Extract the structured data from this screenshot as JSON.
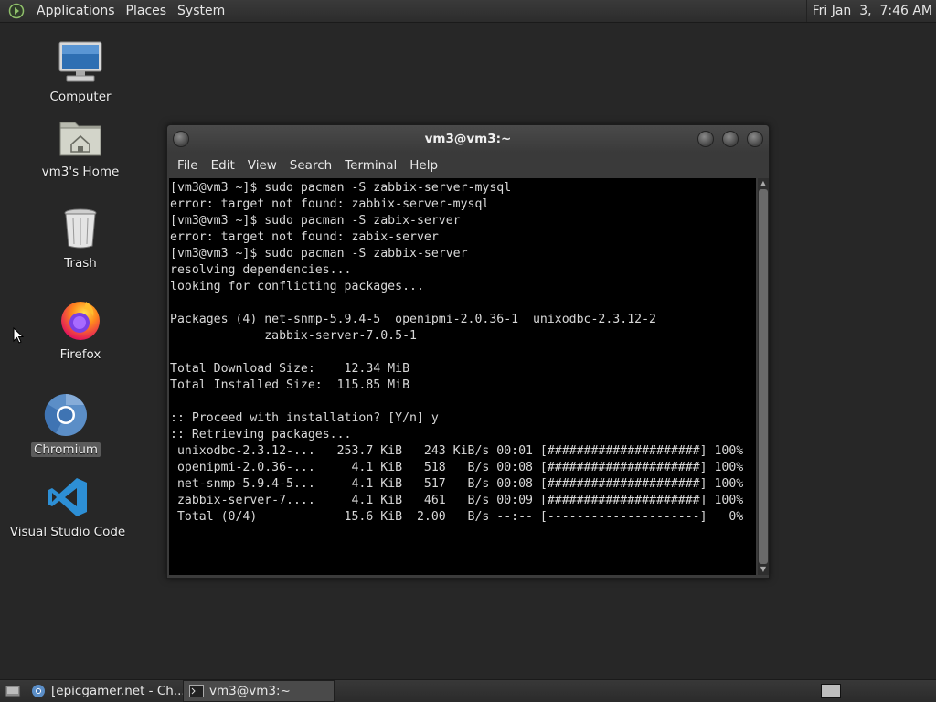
{
  "top_panel": {
    "menus": [
      "Applications",
      "Places",
      "System"
    ],
    "clock": "Fri Jan  3,  7:46 AM"
  },
  "desktop_icons": [
    {
      "label": "Computer",
      "icon": "computer-icon"
    },
    {
      "label": "vm3's Home",
      "icon": "home-folder-icon"
    },
    {
      "label": "Trash",
      "icon": "trash-icon"
    },
    {
      "label": "Firefox",
      "icon": "firefox-icon"
    },
    {
      "label": "Chromium",
      "icon": "chromium-icon",
      "selected": true
    },
    {
      "label": "Visual Studio Code",
      "icon": "vscode-icon"
    }
  ],
  "terminal": {
    "title": "vm3@vm3:~",
    "menus": [
      "File",
      "Edit",
      "View",
      "Search",
      "Terminal",
      "Help"
    ],
    "lines": [
      "[vm3@vm3 ~]$ sudo pacman -S zabbix-server-mysql",
      "error: target not found: zabbix-server-mysql",
      "[vm3@vm3 ~]$ sudo pacman -S zabix-server",
      "error: target not found: zabix-server",
      "[vm3@vm3 ~]$ sudo pacman -S zabbix-server",
      "resolving dependencies...",
      "looking for conflicting packages...",
      "",
      "Packages (4) net-snmp-5.9.4-5  openipmi-2.0.36-1  unixodbc-2.3.12-2",
      "             zabbix-server-7.0.5-1",
      "",
      "Total Download Size:    12.34 MiB",
      "Total Installed Size:  115.85 MiB",
      "",
      ":: Proceed with installation? [Y/n] y",
      ":: Retrieving packages...",
      " unixodbc-2.3.12-...   253.7 KiB   243 KiB/s 00:01 [#####################] 100%",
      " openipmi-2.0.36-...     4.1 KiB   518   B/s 00:08 [#####################] 100%",
      " net-snmp-5.9.4-5...     4.1 KiB   517   B/s 00:08 [#####################] 100%",
      " zabbix-server-7....     4.1 KiB   461   B/s 00:09 [#####################] 100%",
      " Total (0/4)            15.6 KiB  2.00   B/s --:-- [---------------------]   0%"
    ]
  },
  "taskbar": {
    "tasks": [
      {
        "label": "[epicgamer.net - Ch...",
        "icon": "chromium-icon",
        "active": false
      },
      {
        "label": "vm3@vm3:~",
        "icon": "terminal-icon",
        "active": true
      }
    ]
  }
}
